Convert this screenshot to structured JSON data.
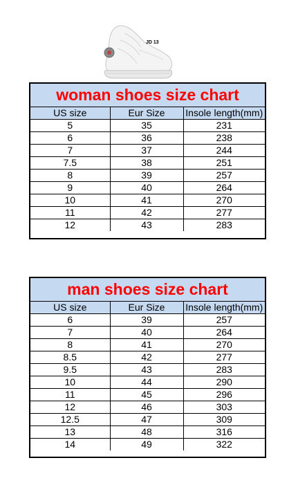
{
  "product_image": {
    "label": "JD 13"
  },
  "woman_chart": {
    "title": "woman shoes size chart",
    "headers": [
      "US size",
      "Eur Size",
      "Insole length(mm)"
    ],
    "rows": [
      [
        "5",
        "35",
        "231"
      ],
      [
        "6",
        "36",
        "238"
      ],
      [
        "7",
        "37",
        "244"
      ],
      [
        "7.5",
        "38",
        "251"
      ],
      [
        "8",
        "39",
        "257"
      ],
      [
        "9",
        "40",
        "264"
      ],
      [
        "10",
        "41",
        "270"
      ],
      [
        "11",
        "42",
        "277"
      ],
      [
        "12",
        "43",
        "283"
      ]
    ]
  },
  "man_chart": {
    "title": "man shoes size chart",
    "headers": [
      "US size",
      "Eur Size",
      "Insole length(mm)"
    ],
    "rows": [
      [
        "6",
        "39",
        "257"
      ],
      [
        "7",
        "40",
        "264"
      ],
      [
        "8",
        "41",
        "270"
      ],
      [
        "8.5",
        "42",
        "277"
      ],
      [
        "9.5",
        "43",
        "283"
      ],
      [
        "10",
        "44",
        "290"
      ],
      [
        "11",
        "45",
        "296"
      ],
      [
        "12",
        "46",
        "303"
      ],
      [
        "12.5",
        "47",
        "309"
      ],
      [
        "13",
        "48",
        "316"
      ],
      [
        "14",
        "49",
        "322"
      ]
    ]
  }
}
